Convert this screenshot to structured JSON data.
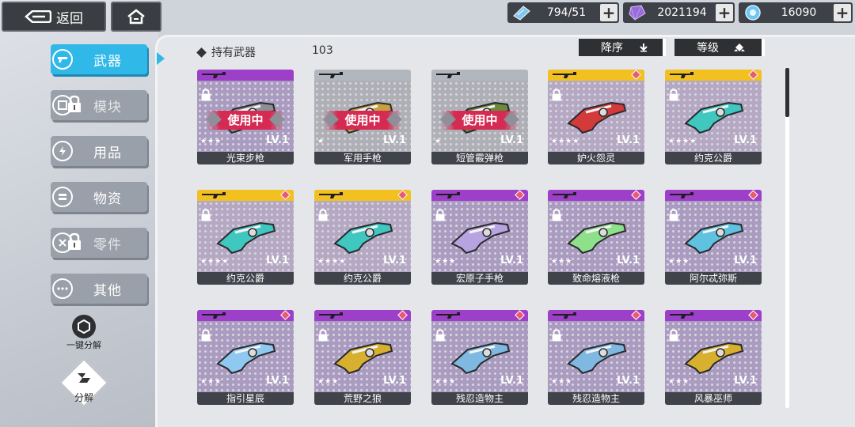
{
  "topbar": {
    "back_label": "返回",
    "resources": [
      {
        "icon": "ticket-icon",
        "value": "794/51",
        "color": "#7fc6f0"
      },
      {
        "icon": "crystal-icon",
        "value": "2021194",
        "color": "#9b6bd8"
      },
      {
        "icon": "energy-orb-icon",
        "value": "16090",
        "color": "#6ec4f5"
      }
    ]
  },
  "sidebar": {
    "items": [
      {
        "label": "武器",
        "active": true,
        "locked": false,
        "icon": "weapon-icon"
      },
      {
        "label": "模块",
        "active": false,
        "locked": true,
        "icon": "module-icon"
      },
      {
        "label": "用品",
        "active": false,
        "locked": false,
        "icon": "lightning-icon"
      },
      {
        "label": "物资",
        "active": false,
        "locked": false,
        "icon": "supplies-icon"
      },
      {
        "label": "零件",
        "active": false,
        "locked": true,
        "icon": "parts-icon"
      },
      {
        "label": "其他",
        "active": false,
        "locked": false,
        "icon": "more-icon"
      }
    ],
    "quick_decompose_label": "一键分解",
    "decompose_label": "分解"
  },
  "header": {
    "owned_label": "持有武器",
    "owned_count": "103",
    "sort_label": "降序",
    "level_label": "等级"
  },
  "cards": [
    {
      "name": "光束步枪",
      "rarity": "purple",
      "stars": "★★★",
      "level": "LV.1",
      "in_use": true,
      "locked": true,
      "gem": false
    },
    {
      "name": "军用手枪",
      "rarity": "gray",
      "stars": "★",
      "level": "LV.1",
      "in_use": true,
      "locked": false,
      "gem": false
    },
    {
      "name": "短管霰弹枪",
      "rarity": "gray",
      "stars": "★",
      "level": "LV.1",
      "in_use": true,
      "locked": false,
      "gem": false
    },
    {
      "name": "妒火怨灵",
      "rarity": "gold",
      "stars": "★★★★",
      "level": "LV.1",
      "in_use": false,
      "locked": true,
      "gem": true
    },
    {
      "name": "约克公爵",
      "rarity": "gold",
      "stars": "★★★★",
      "level": "LV.1",
      "in_use": false,
      "locked": true,
      "gem": true
    },
    {
      "name": "约克公爵",
      "rarity": "gold",
      "stars": "★★★★",
      "level": "LV.1",
      "in_use": false,
      "locked": true,
      "gem": true
    },
    {
      "name": "约克公爵",
      "rarity": "gold",
      "stars": "★★★★",
      "level": "LV.1",
      "in_use": false,
      "locked": true,
      "gem": true
    },
    {
      "name": "宏原子手枪",
      "rarity": "purple",
      "stars": "★★★",
      "level": "LV.1",
      "in_use": false,
      "locked": true,
      "gem": true
    },
    {
      "name": "致命熔液枪",
      "rarity": "purple",
      "stars": "★★★",
      "level": "LV.1",
      "in_use": false,
      "locked": true,
      "gem": true
    },
    {
      "name": "阿尔忒弥斯",
      "rarity": "purple",
      "stars": "★★★",
      "level": "LV.1",
      "in_use": false,
      "locked": true,
      "gem": true
    },
    {
      "name": "指引星辰",
      "rarity": "purple",
      "stars": "★★★",
      "level": "LV.1",
      "in_use": false,
      "locked": true,
      "gem": true
    },
    {
      "name": "荒野之狼",
      "rarity": "purple",
      "stars": "★★★",
      "level": "LV.1",
      "in_use": false,
      "locked": true,
      "gem": true
    },
    {
      "name": "残忍造物主",
      "rarity": "purple",
      "stars": "★★★",
      "level": "LV.1",
      "in_use": false,
      "locked": true,
      "gem": true
    },
    {
      "name": "残忍造物主",
      "rarity": "purple",
      "stars": "★★★",
      "level": "LV.1",
      "in_use": false,
      "locked": true,
      "gem": true
    },
    {
      "name": "风暴巫师",
      "rarity": "purple",
      "stars": "★★★",
      "level": "LV.1",
      "in_use": false,
      "locked": true,
      "gem": true
    }
  ],
  "in_use_label": "使用中",
  "weapon_colors": [
    "#8c8f96",
    "#c9a040",
    "#6d8a3a",
    "#d33a3a",
    "#3fc7c0",
    "#3fc7c0",
    "#3fc7c0",
    "#b7a3e0",
    "#8fe08a",
    "#5fc2e0",
    "#8fc8f0",
    "#d8b030",
    "#7fb8e0",
    "#7fb8e0",
    "#d8b030"
  ]
}
